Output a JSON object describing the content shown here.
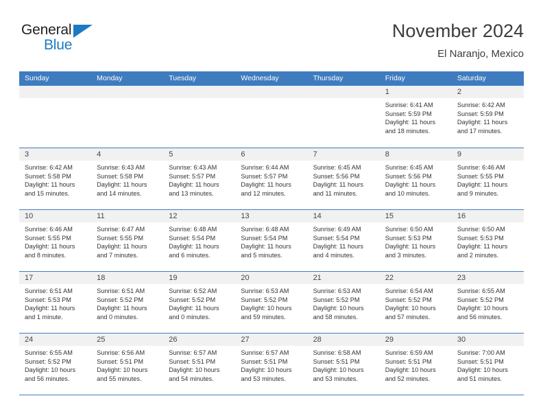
{
  "brand": {
    "name_top": "General",
    "name_bottom": "Blue",
    "triangle_color": "#1b7ac4",
    "text_color": "#231f20"
  },
  "header": {
    "title": "November 2024",
    "subtitle": "El Naranjo, Mexico"
  },
  "colors": {
    "header_blue": "#3f7cbf",
    "daynum_band": "#f1f1f1",
    "body_text": "#333333"
  },
  "weekdays": [
    "Sunday",
    "Monday",
    "Tuesday",
    "Wednesday",
    "Thursday",
    "Friday",
    "Saturday"
  ],
  "weeks": [
    [
      {
        "day": "",
        "empty": true
      },
      {
        "day": "",
        "empty": true
      },
      {
        "day": "",
        "empty": true
      },
      {
        "day": "",
        "empty": true
      },
      {
        "day": "",
        "empty": true
      },
      {
        "day": "1",
        "sunrise": "Sunrise: 6:41 AM",
        "sunset": "Sunset: 5:59 PM",
        "daylight": "Daylight: 11 hours and 18 minutes."
      },
      {
        "day": "2",
        "sunrise": "Sunrise: 6:42 AM",
        "sunset": "Sunset: 5:59 PM",
        "daylight": "Daylight: 11 hours and 17 minutes."
      }
    ],
    [
      {
        "day": "3",
        "sunrise": "Sunrise: 6:42 AM",
        "sunset": "Sunset: 5:58 PM",
        "daylight": "Daylight: 11 hours and 15 minutes."
      },
      {
        "day": "4",
        "sunrise": "Sunrise: 6:43 AM",
        "sunset": "Sunset: 5:58 PM",
        "daylight": "Daylight: 11 hours and 14 minutes."
      },
      {
        "day": "5",
        "sunrise": "Sunrise: 6:43 AM",
        "sunset": "Sunset: 5:57 PM",
        "daylight": "Daylight: 11 hours and 13 minutes."
      },
      {
        "day": "6",
        "sunrise": "Sunrise: 6:44 AM",
        "sunset": "Sunset: 5:57 PM",
        "daylight": "Daylight: 11 hours and 12 minutes."
      },
      {
        "day": "7",
        "sunrise": "Sunrise: 6:45 AM",
        "sunset": "Sunset: 5:56 PM",
        "daylight": "Daylight: 11 hours and 11 minutes."
      },
      {
        "day": "8",
        "sunrise": "Sunrise: 6:45 AM",
        "sunset": "Sunset: 5:56 PM",
        "daylight": "Daylight: 11 hours and 10 minutes."
      },
      {
        "day": "9",
        "sunrise": "Sunrise: 6:46 AM",
        "sunset": "Sunset: 5:55 PM",
        "daylight": "Daylight: 11 hours and 9 minutes."
      }
    ],
    [
      {
        "day": "10",
        "sunrise": "Sunrise: 6:46 AM",
        "sunset": "Sunset: 5:55 PM",
        "daylight": "Daylight: 11 hours and 8 minutes."
      },
      {
        "day": "11",
        "sunrise": "Sunrise: 6:47 AM",
        "sunset": "Sunset: 5:55 PM",
        "daylight": "Daylight: 11 hours and 7 minutes."
      },
      {
        "day": "12",
        "sunrise": "Sunrise: 6:48 AM",
        "sunset": "Sunset: 5:54 PM",
        "daylight": "Daylight: 11 hours and 6 minutes."
      },
      {
        "day": "13",
        "sunrise": "Sunrise: 6:48 AM",
        "sunset": "Sunset: 5:54 PM",
        "daylight": "Daylight: 11 hours and 5 minutes."
      },
      {
        "day": "14",
        "sunrise": "Sunrise: 6:49 AM",
        "sunset": "Sunset: 5:54 PM",
        "daylight": "Daylight: 11 hours and 4 minutes."
      },
      {
        "day": "15",
        "sunrise": "Sunrise: 6:50 AM",
        "sunset": "Sunset: 5:53 PM",
        "daylight": "Daylight: 11 hours and 3 minutes."
      },
      {
        "day": "16",
        "sunrise": "Sunrise: 6:50 AM",
        "sunset": "Sunset: 5:53 PM",
        "daylight": "Daylight: 11 hours and 2 minutes."
      }
    ],
    [
      {
        "day": "17",
        "sunrise": "Sunrise: 6:51 AM",
        "sunset": "Sunset: 5:53 PM",
        "daylight": "Daylight: 11 hours and 1 minute."
      },
      {
        "day": "18",
        "sunrise": "Sunrise: 6:51 AM",
        "sunset": "Sunset: 5:52 PM",
        "daylight": "Daylight: 11 hours and 0 minutes."
      },
      {
        "day": "19",
        "sunrise": "Sunrise: 6:52 AM",
        "sunset": "Sunset: 5:52 PM",
        "daylight": "Daylight: 11 hours and 0 minutes."
      },
      {
        "day": "20",
        "sunrise": "Sunrise: 6:53 AM",
        "sunset": "Sunset: 5:52 PM",
        "daylight": "Daylight: 10 hours and 59 minutes."
      },
      {
        "day": "21",
        "sunrise": "Sunrise: 6:53 AM",
        "sunset": "Sunset: 5:52 PM",
        "daylight": "Daylight: 10 hours and 58 minutes."
      },
      {
        "day": "22",
        "sunrise": "Sunrise: 6:54 AM",
        "sunset": "Sunset: 5:52 PM",
        "daylight": "Daylight: 10 hours and 57 minutes."
      },
      {
        "day": "23",
        "sunrise": "Sunrise: 6:55 AM",
        "sunset": "Sunset: 5:52 PM",
        "daylight": "Daylight: 10 hours and 56 minutes."
      }
    ],
    [
      {
        "day": "24",
        "sunrise": "Sunrise: 6:55 AM",
        "sunset": "Sunset: 5:52 PM",
        "daylight": "Daylight: 10 hours and 56 minutes."
      },
      {
        "day": "25",
        "sunrise": "Sunrise: 6:56 AM",
        "sunset": "Sunset: 5:51 PM",
        "daylight": "Daylight: 10 hours and 55 minutes."
      },
      {
        "day": "26",
        "sunrise": "Sunrise: 6:57 AM",
        "sunset": "Sunset: 5:51 PM",
        "daylight": "Daylight: 10 hours and 54 minutes."
      },
      {
        "day": "27",
        "sunrise": "Sunrise: 6:57 AM",
        "sunset": "Sunset: 5:51 PM",
        "daylight": "Daylight: 10 hours and 53 minutes."
      },
      {
        "day": "28",
        "sunrise": "Sunrise: 6:58 AM",
        "sunset": "Sunset: 5:51 PM",
        "daylight": "Daylight: 10 hours and 53 minutes."
      },
      {
        "day": "29",
        "sunrise": "Sunrise: 6:59 AM",
        "sunset": "Sunset: 5:51 PM",
        "daylight": "Daylight: 10 hours and 52 minutes."
      },
      {
        "day": "30",
        "sunrise": "Sunrise: 7:00 AM",
        "sunset": "Sunset: 5:51 PM",
        "daylight": "Daylight: 10 hours and 51 minutes."
      }
    ]
  ]
}
